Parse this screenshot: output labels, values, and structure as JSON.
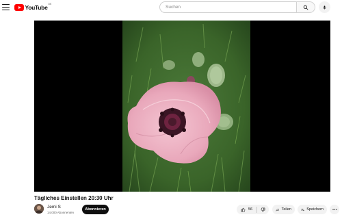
{
  "masthead": {
    "logo_text": "YouTube",
    "logo_region": "DE",
    "search_placeholder": "Suchen",
    "icons": [
      "menu-icon",
      "youtube-logo",
      "search-icon",
      "microphone-icon"
    ]
  },
  "video": {
    "title": "Tägliches Einstellen 20:30 Uhr",
    "thumbnail_subject": "pink-poppy-flower"
  },
  "owner": {
    "channel_name": "Jemi S",
    "subscribers": "14.000 Abonnenten",
    "subscribe_label": "Abonnieren"
  },
  "actions": {
    "like_count": "56",
    "share_label": "Teilen",
    "save_label": "Speichern",
    "icons": [
      "thumbs-up-icon",
      "thumbs-down-icon",
      "share-icon",
      "save-icon",
      "more-icon"
    ]
  },
  "colors": {
    "brand_red": "#ff0000",
    "subscribe_bg": "#0f0f0f",
    "chip_bg": "#f2f2f2",
    "player_bg": "#000000"
  }
}
